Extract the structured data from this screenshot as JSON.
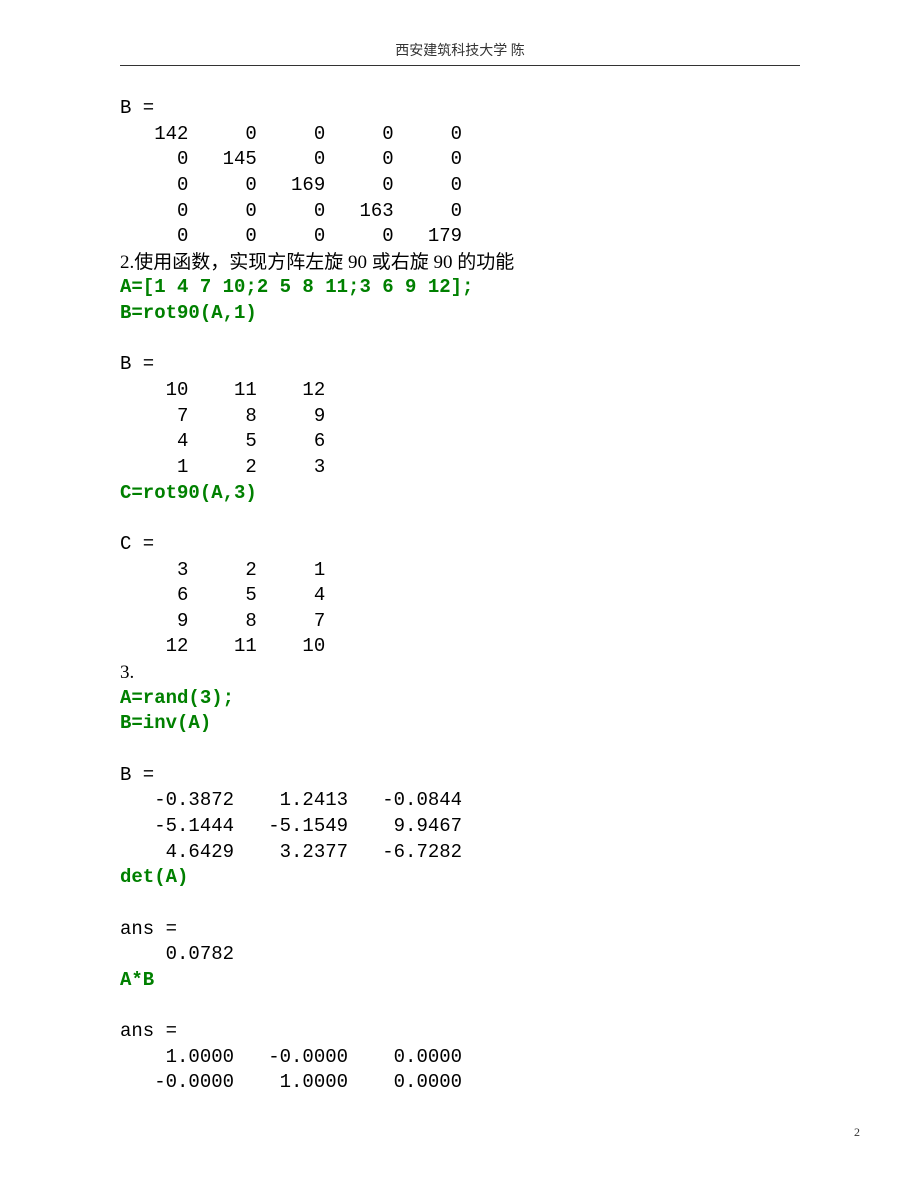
{
  "header": "西安建筑科技大学 陈",
  "blocks": {
    "out_b1": "B =\n   142     0     0     0     0\n     0   145     0     0     0\n     0     0   169     0     0\n     0     0     0   163     0\n     0     0     0     0   179",
    "text_2": "2.使用函数，实现方阵左旋 90 或右旋 90 的功能",
    "code_a1": "A=[1 4 7 10;2 5 8 11;3 6 9 12];\nB=rot90(A,1)",
    "out_b2": "\nB =\n    10    11    12\n     7     8     9\n     4     5     6\n     1     2     3\n",
    "code_c1": "C=rot90(A,3)",
    "out_c1": "\nC =\n     3     2     1\n     6     5     4\n     9     8     7\n    12    11    10",
    "text_3": "3.",
    "code_a2": "A=rand(3);\nB=inv(A)",
    "out_b3": "\nB =\n   -0.3872    1.2413   -0.0844\n   -5.1444   -5.1549    9.9467\n    4.6429    3.2377   -6.7282",
    "code_det": "det(A)",
    "out_ans1": "\nans =\n    0.0782",
    "code_ab": "A*B",
    "out_ans2": "\nans =\n    1.0000   -0.0000    0.0000\n   -0.0000    1.0000    0.0000"
  },
  "page_number": "2"
}
